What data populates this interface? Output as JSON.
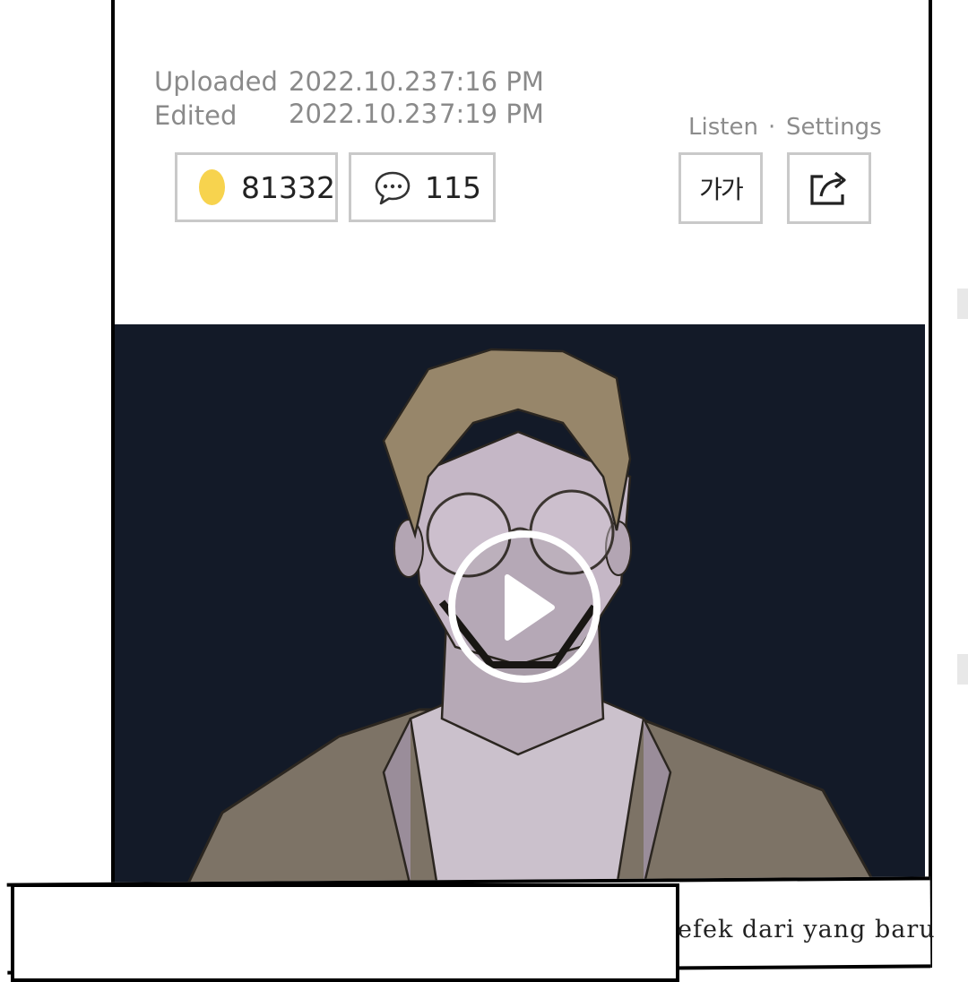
{
  "post_meta": {
    "uploaded_label": "Uploaded",
    "uploaded_date": "2022.10.23",
    "uploaded_time": "7:16 PM",
    "edited_label": "Edited",
    "edited_date": "2022.10.23",
    "edited_time": "7:19 PM"
  },
  "stats": {
    "likes_count": "81332",
    "comments_count": "115",
    "like_icon": "coin-icon",
    "comment_icon": "speech-bubble-icon",
    "like_color": "#f7d34e"
  },
  "utilities": {
    "listen_label": "Listen",
    "separator": "·",
    "settings_label": "Settings",
    "font_button_label": "가가",
    "share_icon": "share-icon"
  },
  "media": {
    "play_icon": "play-icon",
    "background_color": "#131a28"
  },
  "caption": {
    "text": "efek dari yang baru"
  }
}
